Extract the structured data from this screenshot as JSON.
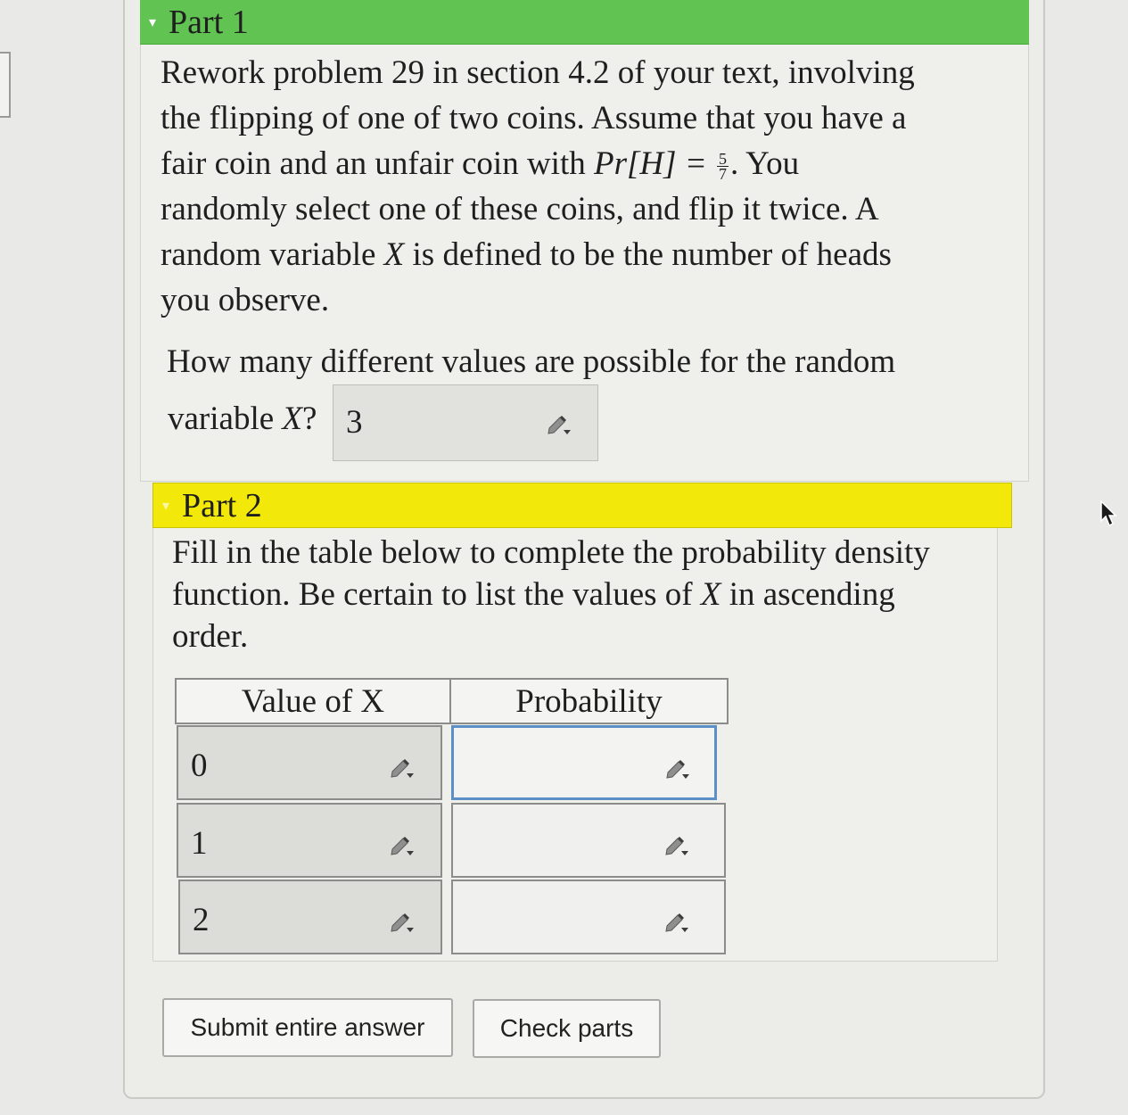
{
  "part1": {
    "title": "Part 1",
    "problem_text": [
      "Rework problem 29 in section 4.2 of your text, involving",
      "the flipping of one of two coins. Assume that you have a",
      "fair coin and an unfair coin with ",
      "randomly select one of these coins, and flip it twice. A",
      "random variable ",
      "you observe."
    ],
    "math_pr": "Pr[H] =",
    "frac_num": "5",
    "frac_den": "7",
    "after_frac": ". You",
    "var_x": "X",
    "line5_rest": " is defined to be the number of heads",
    "question_line1": "How many different values are possible for the random",
    "question_line2_prefix": "variable ",
    "question_line2_suffix": "?",
    "answer_value": "3"
  },
  "part2": {
    "title": "Part 2",
    "instruction_line1": "Fill in the table below to complete the probability density",
    "instruction_line2_prefix": "function. Be certain to list the values of ",
    "instruction_line2_suffix": " in ascending",
    "instruction_line3": "order.",
    "table": {
      "headers": [
        "Value of X",
        "Probability"
      ],
      "rows": [
        {
          "x": "0",
          "p": ""
        },
        {
          "x": "1",
          "p": ""
        },
        {
          "x": "2",
          "p": ""
        }
      ]
    }
  },
  "buttons": {
    "submit": "Submit entire answer",
    "check": "Check parts"
  },
  "colors": {
    "part1_header": "#61c352",
    "part2_header": "#f2e80a",
    "focus_border": "#5b8fc5"
  },
  "icons": {
    "answer_edit": "pencil-dropdown-icon",
    "collapse": "caret-down-icon",
    "cursor": "mouse-pointer-icon"
  }
}
